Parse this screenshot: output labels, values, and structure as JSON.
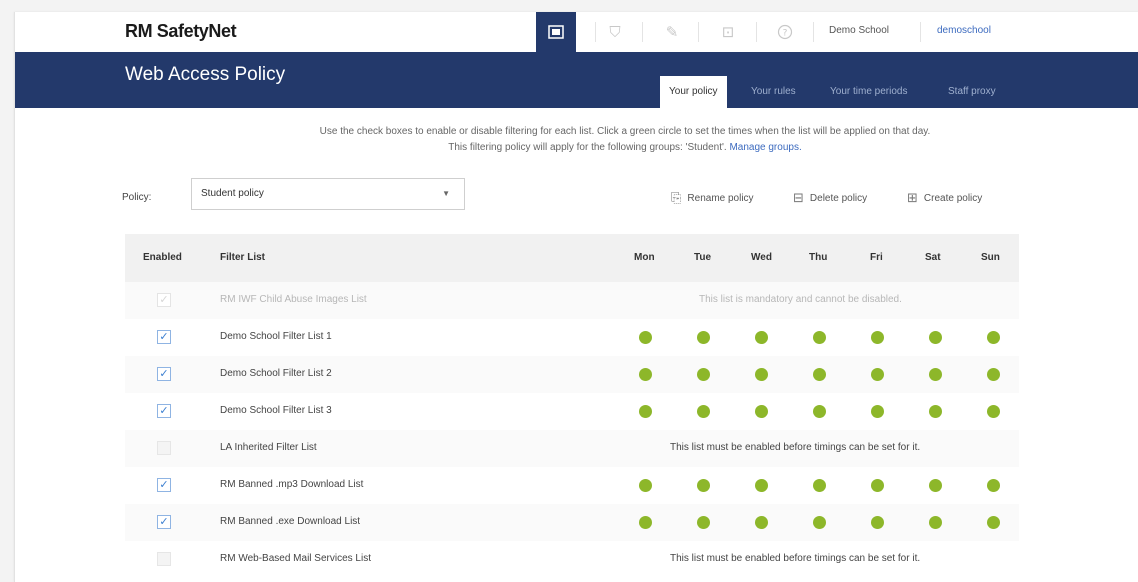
{
  "app": {
    "logo": "RM SafetyNet",
    "school_name": "Demo School",
    "username": "demoschool"
  },
  "top_icons": [
    {
      "name": "policy-icon",
      "glyph": "▣",
      "active": true
    },
    {
      "name": "shield-icon",
      "glyph": "⛉",
      "active": false
    },
    {
      "name": "tools-icon",
      "glyph": "✎",
      "active": false
    },
    {
      "name": "monitor-icon",
      "glyph": "⊡",
      "active": false
    },
    {
      "name": "help-icon",
      "glyph": "?",
      "active": false
    }
  ],
  "header": {
    "title": "Web Access Policy",
    "tabs": [
      {
        "label": "Your policy",
        "active": true
      },
      {
        "label": "Your rules",
        "active": false
      },
      {
        "label": "Your time periods",
        "active": false
      },
      {
        "label": "Staff proxy",
        "active": false
      }
    ]
  },
  "intro": {
    "line1": "Use the check boxes to enable or disable filtering for each list. Click a green circle to set the times when the list will be applied on that day.",
    "line2": "This filtering policy will apply for the following groups: 'Student'.",
    "manage_link": "Manage groups."
  },
  "policy": {
    "label": "Policy:",
    "selected": "Student policy",
    "actions": {
      "rename": "Rename policy",
      "delete": "Delete policy",
      "create": "Create policy"
    }
  },
  "table": {
    "headers": {
      "enabled": "Enabled",
      "filter_list": "Filter List",
      "days": [
        "Mon",
        "Tue",
        "Wed",
        "Thu",
        "Fri",
        "Sat",
        "Sun"
      ]
    },
    "rows": [
      {
        "name": "RM IWF Child Abuse Images List",
        "state": "mandatory",
        "note": "This list is mandatory and cannot be disabled."
      },
      {
        "name": "Demo School Filter List 1",
        "state": "enabled"
      },
      {
        "name": "Demo School Filter List 2",
        "state": "enabled"
      },
      {
        "name": "Demo School Filter List 3",
        "state": "enabled"
      },
      {
        "name": "LA Inherited Filter List",
        "state": "disabled",
        "note": "This list must be enabled before timings can be set for it."
      },
      {
        "name": "RM Banned .mp3 Download List",
        "state": "enabled"
      },
      {
        "name": "RM Banned .exe Download List",
        "state": "enabled"
      },
      {
        "name": "RM Web-Based Mail Services List",
        "state": "disabled",
        "note": "This list must be enabled before timings can be set for it."
      }
    ]
  },
  "colors": {
    "header_bg": "#23396b",
    "dot_green": "#8db72a",
    "link_blue": "#3d6bbf"
  }
}
